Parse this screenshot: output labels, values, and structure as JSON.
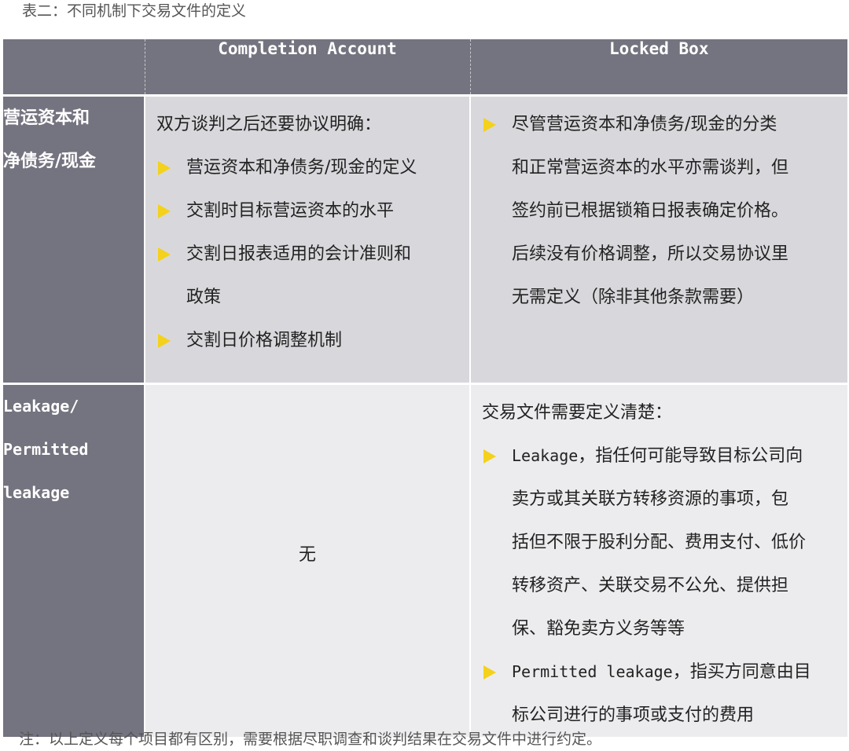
{
  "caption": "表二：不同机制下交易文件的定义",
  "header": {
    "col1": "",
    "col2": "Completion Account",
    "col3": "Locked Box"
  },
  "rows": [
    {
      "head_lines": [
        "营运资本和",
        "净债务/现金"
      ],
      "completion": {
        "intro": "双方谈判之后还要协议明确：",
        "bullets": [
          [
            "营运资本和净债务/现金的定义"
          ],
          [
            "交割时目标营运资本的水平"
          ],
          [
            "交割日报表适用的会计准则和",
            "政策"
          ],
          [
            "交割日价格调整机制"
          ]
        ]
      },
      "locked_box": {
        "bullets": [
          [
            "尽管营运资本和净债务/现金的分类",
            "和正常营运资本的水平亦需谈判，但",
            "签约前已根据锁箱日报表确定价格。",
            "后续没有价格调整，所以交易协议里",
            "无需定义（除非其他条款需要）"
          ]
        ]
      }
    },
    {
      "head_lines": [
        "Leakage/",
        "Permitted",
        "leakage"
      ],
      "completion": {
        "text": "无"
      },
      "locked_box": {
        "intro": "交易文件需要定义清楚：",
        "bullets": [
          {
            "term": "Leakage",
            "lines": [
              "，指任何可能导致目标公司向",
              "卖方或其关联方转移资源的事项，包",
              "括但不限于股利分配、费用支付、低价",
              "转移资产、关联交易不公允、提供担",
              "保、豁免卖方义务等等"
            ]
          },
          {
            "term": "Permitted leakage",
            "lines": [
              "，指买方同意由目",
              "标公司进行的事项或支付的费用"
            ]
          }
        ]
      }
    }
  ],
  "footnote": "注：以上定义每个项目都有区别，需要根据尽职调查和谈判结果在交易文件中进行约定。",
  "colors": {
    "header_bg": "#747480",
    "row1_bg": "#d8d8dc",
    "row2_bg": "#ececee",
    "bullet": "#f4d11b"
  },
  "icons": {
    "bullet": "yellow-triangle-bullet-icon"
  }
}
